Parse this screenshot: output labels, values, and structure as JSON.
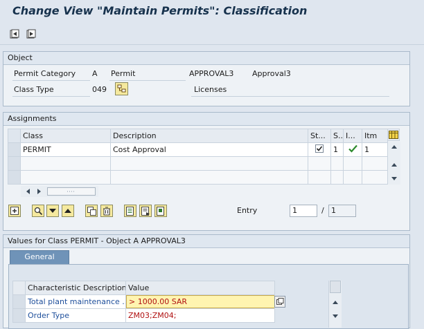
{
  "window": {
    "title": "Change View \"Maintain Permits\": Classification"
  },
  "toolbar": {
    "icons": [
      "previous-entry-icon",
      "next-entry-icon"
    ]
  },
  "object_group": {
    "title": "Object",
    "permit_category_label": "Permit Category",
    "permit_category_value": "A",
    "permit_text": "Permit",
    "permit_id": "APPROVAL3",
    "permit_desc": "Approval3",
    "class_type_label": "Class Type",
    "class_type_value": "049",
    "class_type_desc": "Licenses"
  },
  "assignments": {
    "title": "Assignments",
    "columns": [
      "Class",
      "Description",
      "St...",
      "S...",
      "I...",
      "Itm"
    ],
    "rows": [
      {
        "class": "PERMIT",
        "description": "Cost Approval",
        "status_checked": true,
        "s": "1",
        "i_ok": true,
        "itm": "1"
      }
    ],
    "entry_label": "Entry",
    "entry_value": "1",
    "entry_separator": "/",
    "entry_total": "1"
  },
  "values_group": {
    "title": "Values for Class PERMIT - Object A APPROVAL3",
    "tab_label": "General",
    "columns": [
      "Characteristic Description",
      "Value"
    ],
    "rows": [
      {
        "characteristic": "Total plant maintenance ...",
        "value": "> 1000.00 SAR"
      },
      {
        "characteristic": "Order Type",
        "value": "ZM03;ZM04;"
      }
    ]
  },
  "colors": {
    "title": "#17324d",
    "tab": "#6f93b8",
    "link": "#1e4f9b",
    "value_text": "#b01010",
    "input_highlight": "#fff4b0"
  }
}
